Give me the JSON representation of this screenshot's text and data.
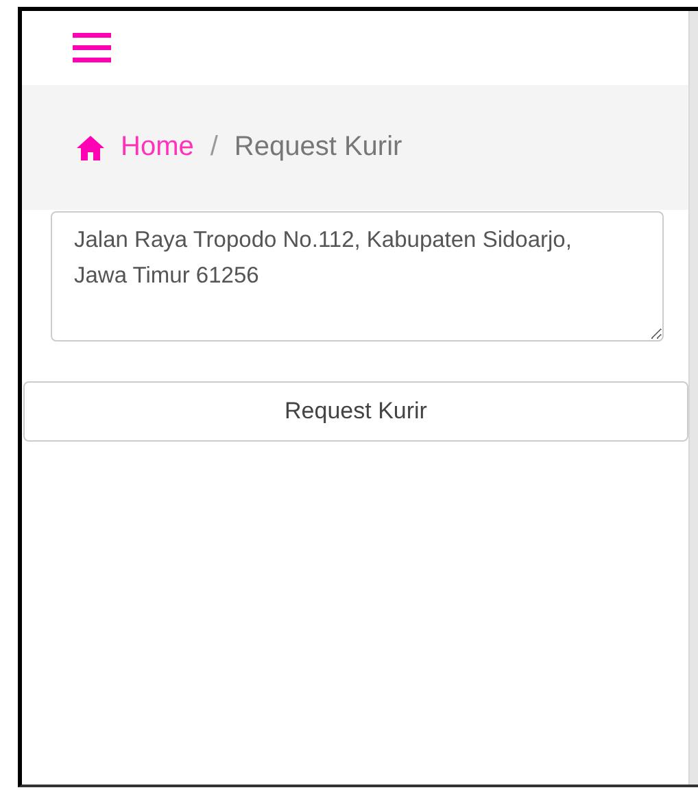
{
  "breadcrumb": [
    {
      "label": "Home",
      "kind": "link"
    },
    {
      "label": "Request Kurir",
      "kind": "current"
    }
  ],
  "breadcrumb_separator": "/",
  "address": {
    "value": "Jalan Raya Tropodo No.112, Kabupaten Sidoarjo, Jawa Timur 61256"
  },
  "button": "Request Kurir"
}
